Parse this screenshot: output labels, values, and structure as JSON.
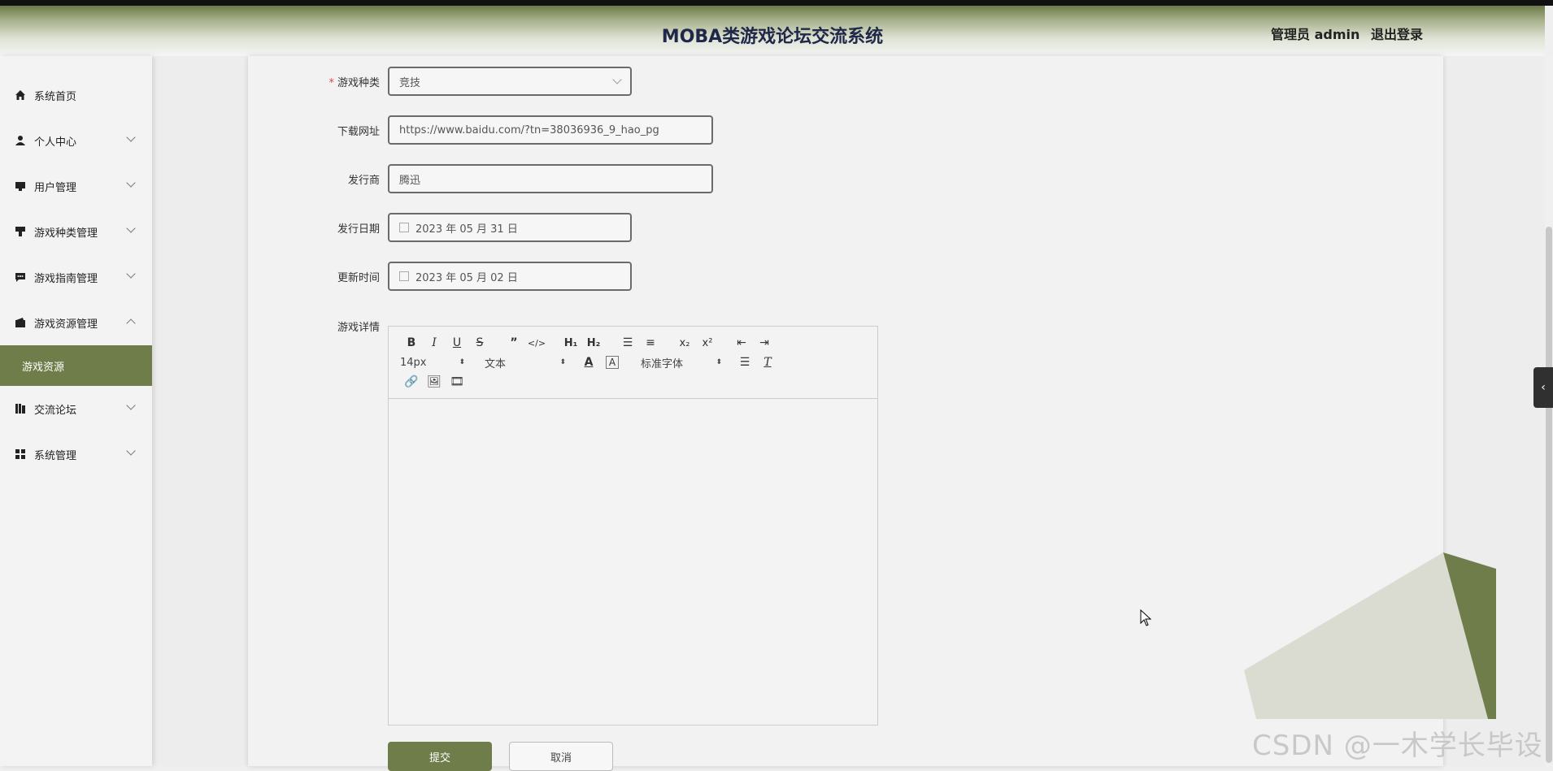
{
  "header": {
    "title": "MOBA类游戏论坛交流系统",
    "user_label": "管理员 admin",
    "logout_label": "退出登录"
  },
  "sidebar": {
    "items": [
      {
        "label": "系统首页",
        "icon": "home-icon"
      },
      {
        "label": "个人中心",
        "icon": "person-icon"
      },
      {
        "label": "用户管理",
        "icon": "monitor-icon"
      },
      {
        "label": "游戏种类管理",
        "icon": "paint-icon"
      },
      {
        "label": "游戏指南管理",
        "icon": "chat-icon"
      },
      {
        "label": "游戏资源管理",
        "icon": "wallet-icon"
      },
      {
        "label": "交流论坛",
        "icon": "books-icon"
      },
      {
        "label": "系统管理",
        "icon": "grid-icon"
      }
    ],
    "active_sub": "游戏资源"
  },
  "form": {
    "category_label": "游戏种类",
    "category_value": "竞技",
    "url_label": "下载网址",
    "url_value": "https://www.baidu.com/?tn=38036936_9_hao_pg",
    "publisher_label": "发行商",
    "publisher_value": "腾迅",
    "release_label": "发行日期",
    "release_value": "2023 年 05 月 31 日",
    "update_label": "更新时间",
    "update_value": "2023 年 05 月 02 日",
    "detail_label": "游戏详情"
  },
  "editor": {
    "font_size": "14px",
    "text_type": "文本",
    "font_family": "标准字体"
  },
  "buttons": {
    "submit": "提交",
    "cancel": "取消"
  },
  "watermark": "CSDN @一木学长毕设",
  "colors": {
    "accent": "#6f7d4b",
    "title": "#20284a"
  }
}
